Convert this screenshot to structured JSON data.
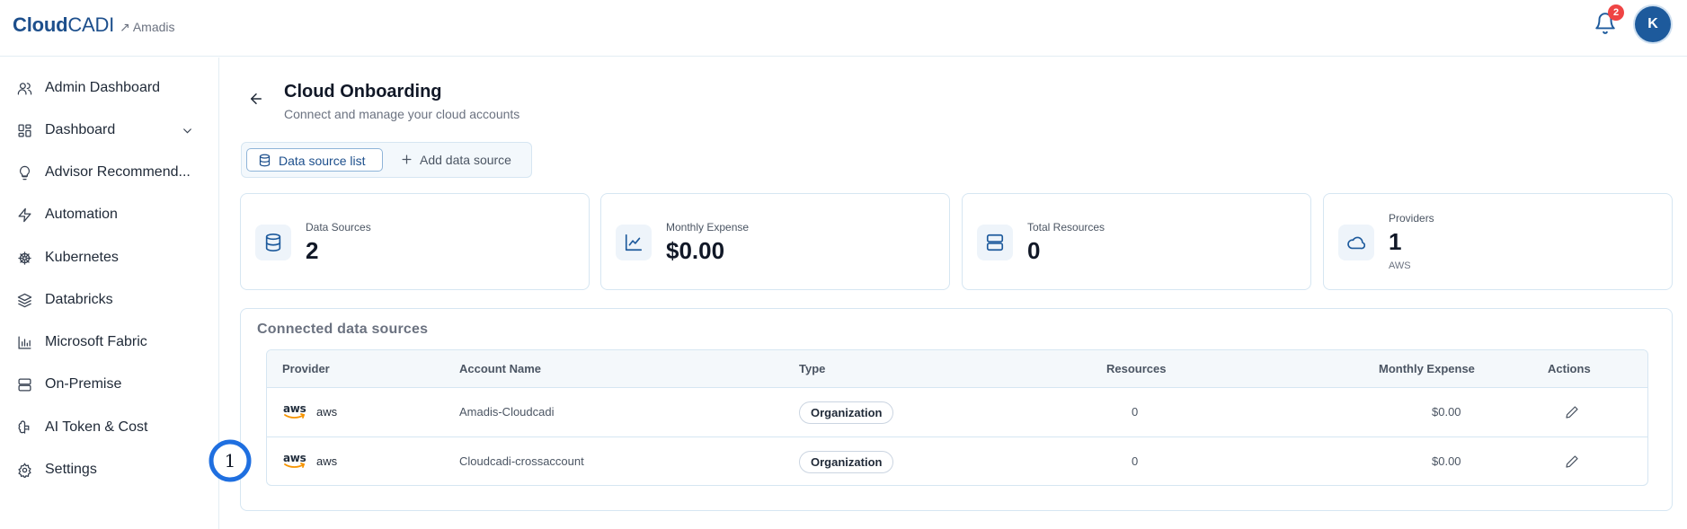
{
  "header": {
    "brand_bold": "Cloud",
    "brand_light": "CADI",
    "tenant": "↗ Amadis",
    "notification_count": "2",
    "avatar_initial": "K"
  },
  "sidebar": {
    "items": [
      {
        "label": "Admin Dashboard",
        "icon": "users-icon"
      },
      {
        "label": "Dashboard",
        "icon": "grid-icon",
        "expandable": true
      },
      {
        "label": "Advisor Recommend...",
        "icon": "lightbulb-icon"
      },
      {
        "label": "Automation",
        "icon": "bolt-icon"
      },
      {
        "label": "Kubernetes",
        "icon": "helm-icon"
      },
      {
        "label": "Databricks",
        "icon": "layers-icon"
      },
      {
        "label": "Microsoft Fabric",
        "icon": "bar-chart-icon"
      },
      {
        "label": "On-Premise",
        "icon": "server-icon"
      },
      {
        "label": "AI Token & Cost",
        "icon": "brain-icon"
      },
      {
        "label": "Settings",
        "icon": "gear-icon"
      }
    ]
  },
  "page": {
    "title": "Cloud Onboarding",
    "subtitle": "Connect and manage your cloud accounts"
  },
  "tabs": {
    "active": "Data source list",
    "other": "Add data source"
  },
  "stats": [
    {
      "label": "Data Sources",
      "value": "2",
      "icon": "database-icon"
    },
    {
      "label": "Monthly Expense",
      "value": "$0.00",
      "icon": "line-chart-icon"
    },
    {
      "label": "Total Resources",
      "value": "0",
      "icon": "server-icon"
    },
    {
      "label": "Providers",
      "value": "1",
      "sub": "AWS",
      "icon": "cloud-icon"
    }
  ],
  "sources": {
    "title": "Connected data sources",
    "columns": [
      "Provider",
      "Account Name",
      "Type",
      "Resources",
      "Monthly Expense",
      "Actions"
    ],
    "rows": [
      {
        "logo": "aws",
        "provider": "aws",
        "account": "Amadis-Cloudcadi",
        "type": "Organization",
        "resources": "0",
        "expense": "$0.00"
      },
      {
        "logo": "aws",
        "provider": "aws",
        "account": "Cloudcadi-crossaccount",
        "type": "Organization",
        "resources": "0",
        "expense": "$0.00"
      }
    ]
  },
  "annotation": {
    "marker_label": "1"
  },
  "colors": {
    "brand": "#1d4f8c",
    "accent": "#1d5a9c",
    "badge_red": "#ef4444",
    "marker_blue": "#1f6fe0"
  }
}
